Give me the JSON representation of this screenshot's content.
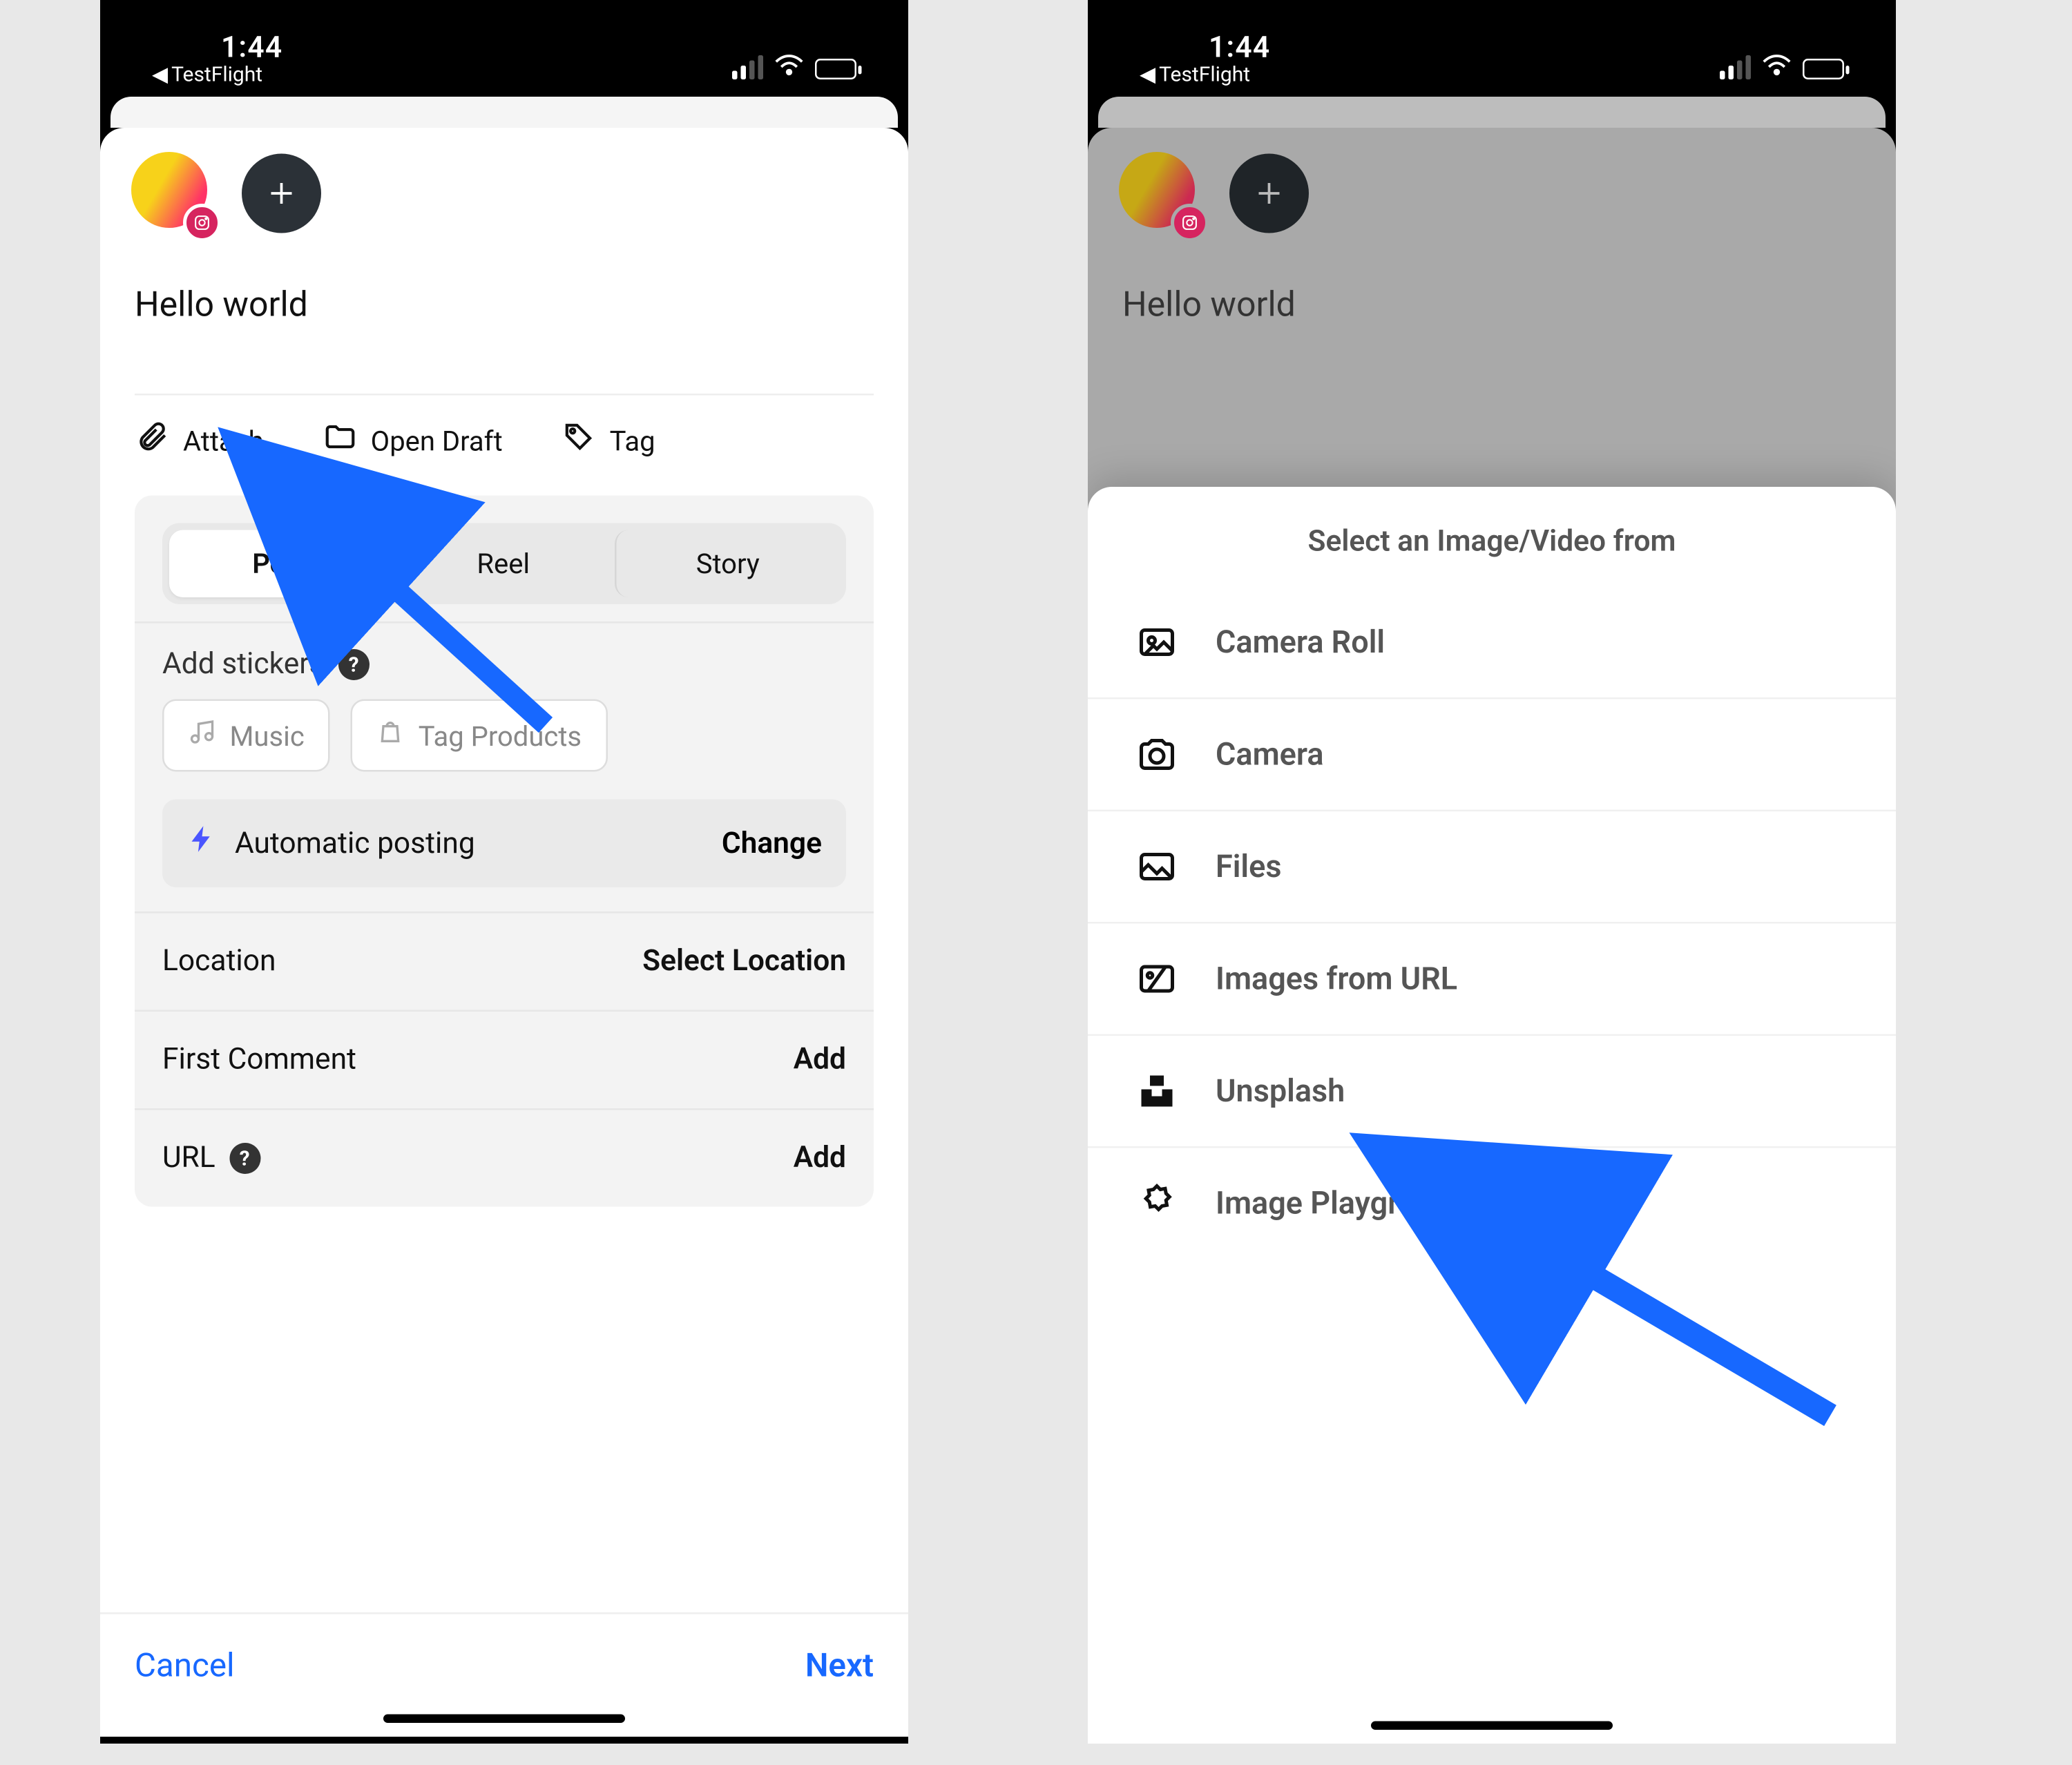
{
  "status": {
    "time": "1:44",
    "back_app": "TestFlight"
  },
  "compose": {
    "text": "Hello world",
    "actions": {
      "attach": "Attach",
      "open_draft": "Open Draft",
      "tag": "Tag"
    },
    "segments": [
      "Post",
      "Reel",
      "Story"
    ],
    "stickers_label": "Add stickers",
    "chips": {
      "music": "Music",
      "tag_products": "Tag Products"
    },
    "auto_posting": {
      "label": "Automatic posting",
      "action": "Change"
    },
    "rows": {
      "location": {
        "label": "Location",
        "value": "Select Location"
      },
      "first_comment": {
        "label": "First Comment",
        "value": "Add"
      },
      "url": {
        "label": "URL",
        "value": "Add"
      }
    },
    "footer": {
      "cancel": "Cancel",
      "next": "Next"
    }
  },
  "picker": {
    "title": "Select an Image/Video from",
    "options": [
      {
        "icon": "image-icon",
        "label": "Camera Roll"
      },
      {
        "icon": "camera-icon",
        "label": "Camera"
      },
      {
        "icon": "picture-icon",
        "label": "Files"
      },
      {
        "icon": "url-image-icon",
        "label": "Images from URL"
      },
      {
        "icon": "unsplash-icon",
        "label": "Unsplash"
      },
      {
        "icon": "playground-icon",
        "label": "Image Playground"
      }
    ]
  }
}
